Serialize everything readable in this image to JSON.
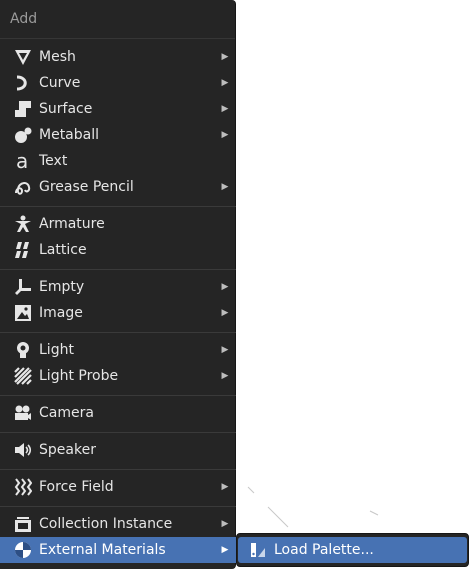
{
  "menu": {
    "title": "Add",
    "items": [
      {
        "label": "Mesh",
        "icon": "mesh-icon",
        "submenu": true
      },
      {
        "label": "Curve",
        "icon": "curve-icon",
        "submenu": true
      },
      {
        "label": "Surface",
        "icon": "surface-icon",
        "submenu": true
      },
      {
        "label": "Metaball",
        "icon": "metaball-icon",
        "submenu": true
      },
      {
        "label": "Text",
        "icon": "text-icon",
        "submenu": false
      },
      {
        "label": "Grease Pencil",
        "icon": "grease-pencil-icon",
        "submenu": true
      },
      {
        "label": "Armature",
        "icon": "armature-icon",
        "submenu": false
      },
      {
        "label": "Lattice",
        "icon": "lattice-icon",
        "submenu": false
      },
      {
        "label": "Empty",
        "icon": "empty-icon",
        "submenu": true
      },
      {
        "label": "Image",
        "icon": "image-icon",
        "submenu": true
      },
      {
        "label": "Light",
        "icon": "light-icon",
        "submenu": true
      },
      {
        "label": "Light Probe",
        "icon": "light-probe-icon",
        "submenu": true
      },
      {
        "label": "Camera",
        "icon": "camera-icon",
        "submenu": false
      },
      {
        "label": "Speaker",
        "icon": "speaker-icon",
        "submenu": false
      },
      {
        "label": "Force Field",
        "icon": "force-field-icon",
        "submenu": true
      },
      {
        "label": "Collection Instance",
        "icon": "collection-icon",
        "submenu": true
      },
      {
        "label": "External Materials",
        "icon": "material-icon",
        "submenu": true,
        "active": true
      }
    ],
    "arrow_glyph": "▶"
  },
  "submenu": {
    "items": [
      {
        "label": "Load Palette...",
        "icon": "palette-icon"
      }
    ]
  },
  "colors": {
    "menu_bg": "#252525",
    "highlight": "#4772b3",
    "text": "#e6e6e6"
  }
}
